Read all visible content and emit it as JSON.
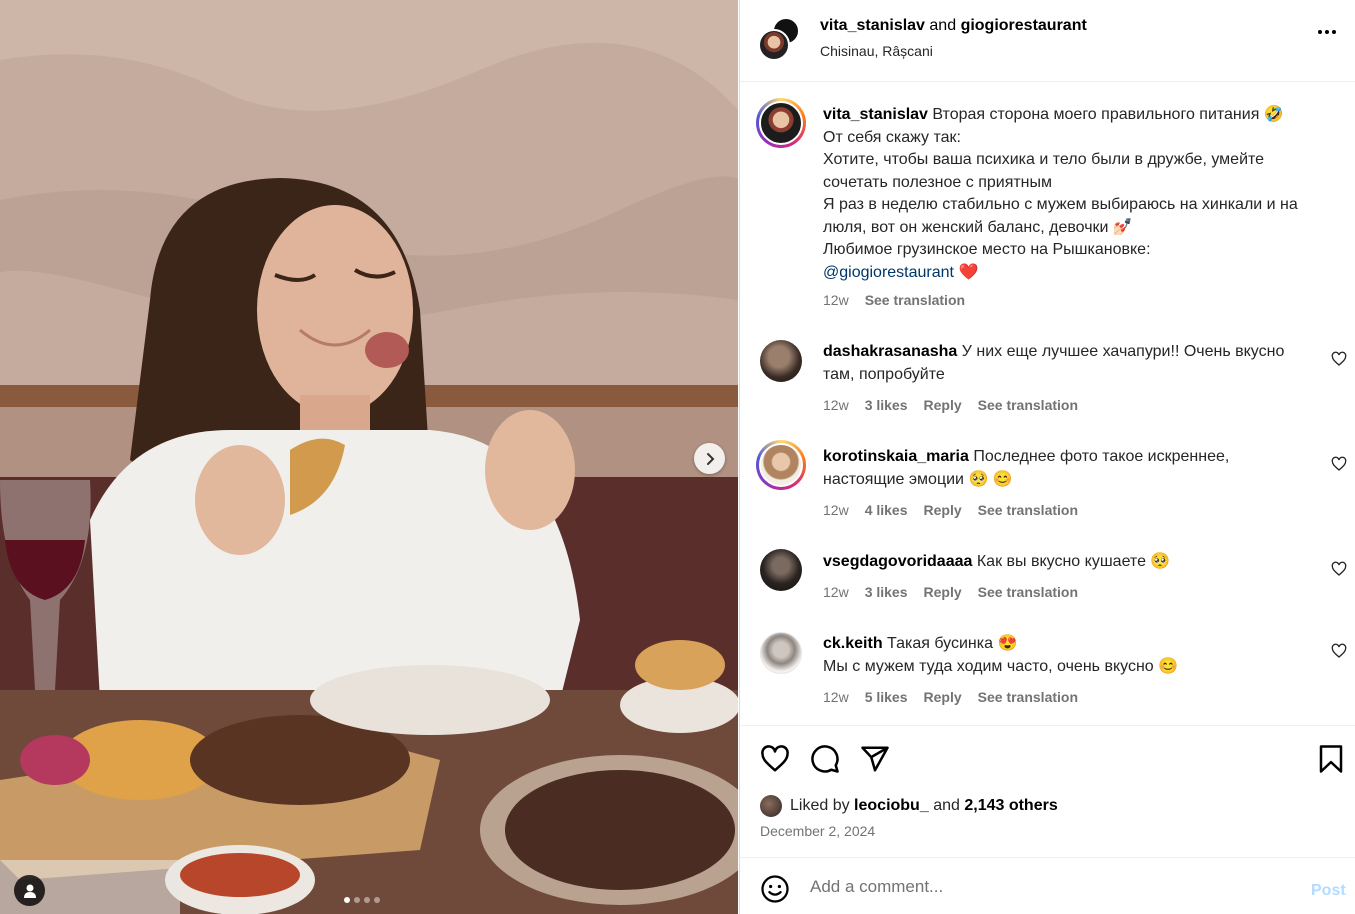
{
  "header": {
    "user1": "vita_stanislav",
    "and": "and",
    "user2": "giogiorestaurant",
    "location": "Chisinau, Râșcani"
  },
  "caption": {
    "username": "vita_stanislav",
    "line1": "Вторая сторона моего правильного питания 🤣",
    "line2": "От себя скажу так:",
    "line3": "Хотите, чтобы ваша психика и тело были в дружбе, умейте сочетать полезное с приятным",
    "line4": "Я раз в неделю стабильно с мужем выбираюсь на хинкали и на люля, вот он женский баланс, девочки 💅🏻",
    "line5": "Любимое грузинское место на Рышкановке:",
    "mention": "@giogiorestaurant",
    "heart": "❤️",
    "time": "12w",
    "see_translation": "See translation"
  },
  "comments": [
    {
      "username": "dashakrasanasha",
      "text": "У них еще лучшее хачапури!! Очень вкусно там, попробуйте",
      "time": "12w",
      "likes": "3 likes",
      "reply": "Reply",
      "see_translation": "See translation"
    },
    {
      "username": "korotinskaia_maria",
      "text": "Последнее фото такое искреннее, настоящие эмоции 🥺 😊",
      "time": "12w",
      "likes": "4 likes",
      "reply": "Reply",
      "see_translation": "See translation"
    },
    {
      "username": "vsegdagovoridaaaa",
      "text": "Как вы вкусно кушаете 🥺",
      "time": "12w",
      "likes": "3 likes",
      "reply": "Reply",
      "see_translation": "See translation"
    },
    {
      "username": "ck.keith",
      "text": "Такая бусинка 😍",
      "text2": "Мы с мужем туда ходим часто, очень вкусно 😊",
      "time": "12w",
      "likes": "5 likes",
      "reply": "Reply",
      "see_translation": "See translation"
    }
  ],
  "likes": {
    "prefix": "Liked by",
    "user": "leociobu_",
    "and": "and",
    "others": "2,143 others"
  },
  "date": "December 2, 2024",
  "add_comment": {
    "placeholder": "Add a comment...",
    "post": "Post"
  },
  "carousel": {
    "current": 1,
    "total": 4
  },
  "icons": {
    "like": "heart-icon",
    "comment": "comment-icon",
    "share": "share-icon",
    "save": "bookmark-icon",
    "emoji": "emoji-icon",
    "more": "more-icon",
    "next": "chevron-right-icon",
    "tag": "user-tag-icon"
  },
  "colors": {
    "link": "#00376b",
    "muted": "#737373",
    "post_disabled": "#b3dbff",
    "liked_red": "#ff3040"
  }
}
